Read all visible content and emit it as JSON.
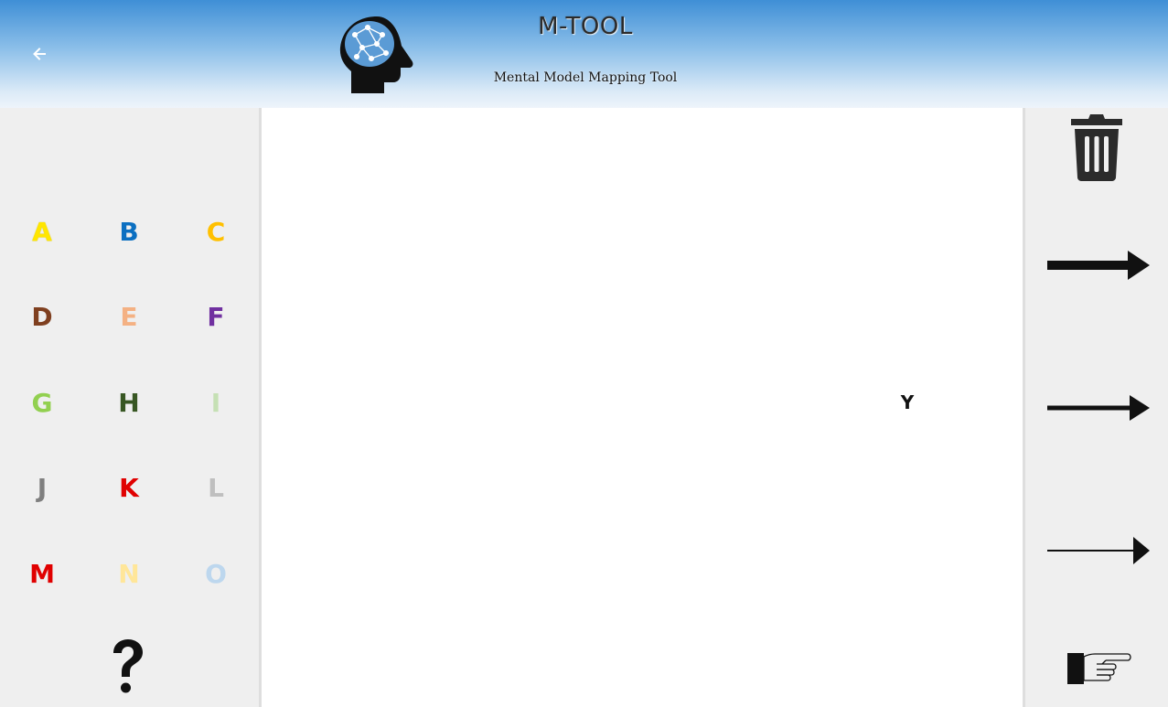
{
  "header": {
    "title": "M-TOOL",
    "subtitle": "Mental Model Mapping Tool",
    "back_icon": "arrow-left-icon",
    "logo_icon": "head-with-brain-network-icon",
    "gradient_top": "#3f8fd6",
    "gradient_bottom": "#eef4fb"
  },
  "palette": {
    "letters": [
      {
        "label": "A",
        "color": "#ffe600"
      },
      {
        "label": "B",
        "color": "#0b6fc1"
      },
      {
        "label": "C",
        "color": "#ffc000"
      },
      {
        "label": "D",
        "color": "#7f3f1f"
      },
      {
        "label": "E",
        "color": "#f4b183"
      },
      {
        "label": "F",
        "color": "#7030a0"
      },
      {
        "label": "G",
        "color": "#92d050"
      },
      {
        "label": "H",
        "color": "#385723"
      },
      {
        "label": "I",
        "color": "#c5e0b4"
      },
      {
        "label": "J",
        "color": "#7f7f7f"
      },
      {
        "label": "K",
        "color": "#e00000"
      },
      {
        "label": "L",
        "color": "#bfbfbf"
      },
      {
        "label": "M",
        "color": "#e00000"
      },
      {
        "label": "N",
        "color": "#ffe699"
      },
      {
        "label": "O",
        "color": "#bdd7ee"
      }
    ],
    "help_icon": "question-mark-icon"
  },
  "canvas": {
    "items": [
      {
        "label": "Y",
        "color": "#111111"
      }
    ]
  },
  "tools": {
    "delete_icon": "trash-icon",
    "arrow_thick_icon": "arrow-thick-icon",
    "arrow_medium_icon": "arrow-medium-icon",
    "arrow_thin_icon": "arrow-thin-icon",
    "pointing_hand_icon": "pointing-hand-icon"
  }
}
